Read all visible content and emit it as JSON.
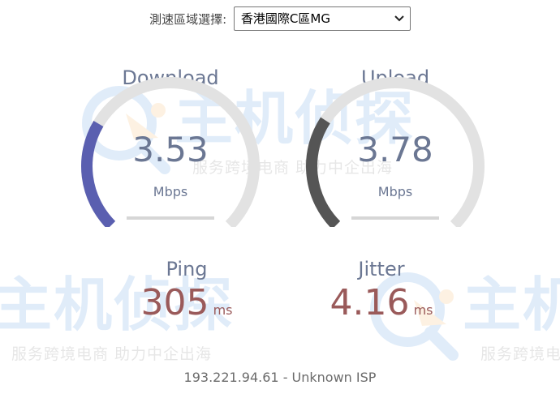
{
  "server": {
    "label": "測速區域選擇:",
    "selected": "香港國際C區MG"
  },
  "download": {
    "title": "Download",
    "value": "3.53",
    "unit": "Mbps",
    "arc_fraction": 0.28,
    "color": "#5a5fb0"
  },
  "upload": {
    "title": "Upload",
    "value": "3.78",
    "unit": "Mbps",
    "arc_fraction": 0.29,
    "color": "#555555"
  },
  "ping": {
    "title": "Ping",
    "value": "305",
    "unit": "ms"
  },
  "jitter": {
    "title": "Jitter",
    "value": "4.16",
    "unit": "ms"
  },
  "ip_info": "193.221.94.61 - Unknown ISP",
  "watermark": {
    "title": "主机侦探",
    "subtitle": "服务跨境电商 助力中企出海"
  },
  "colors": {
    "gauge_track": "#e2e2e2",
    "label_text": "#6b7793",
    "metric_value": "#9a5a5a"
  }
}
